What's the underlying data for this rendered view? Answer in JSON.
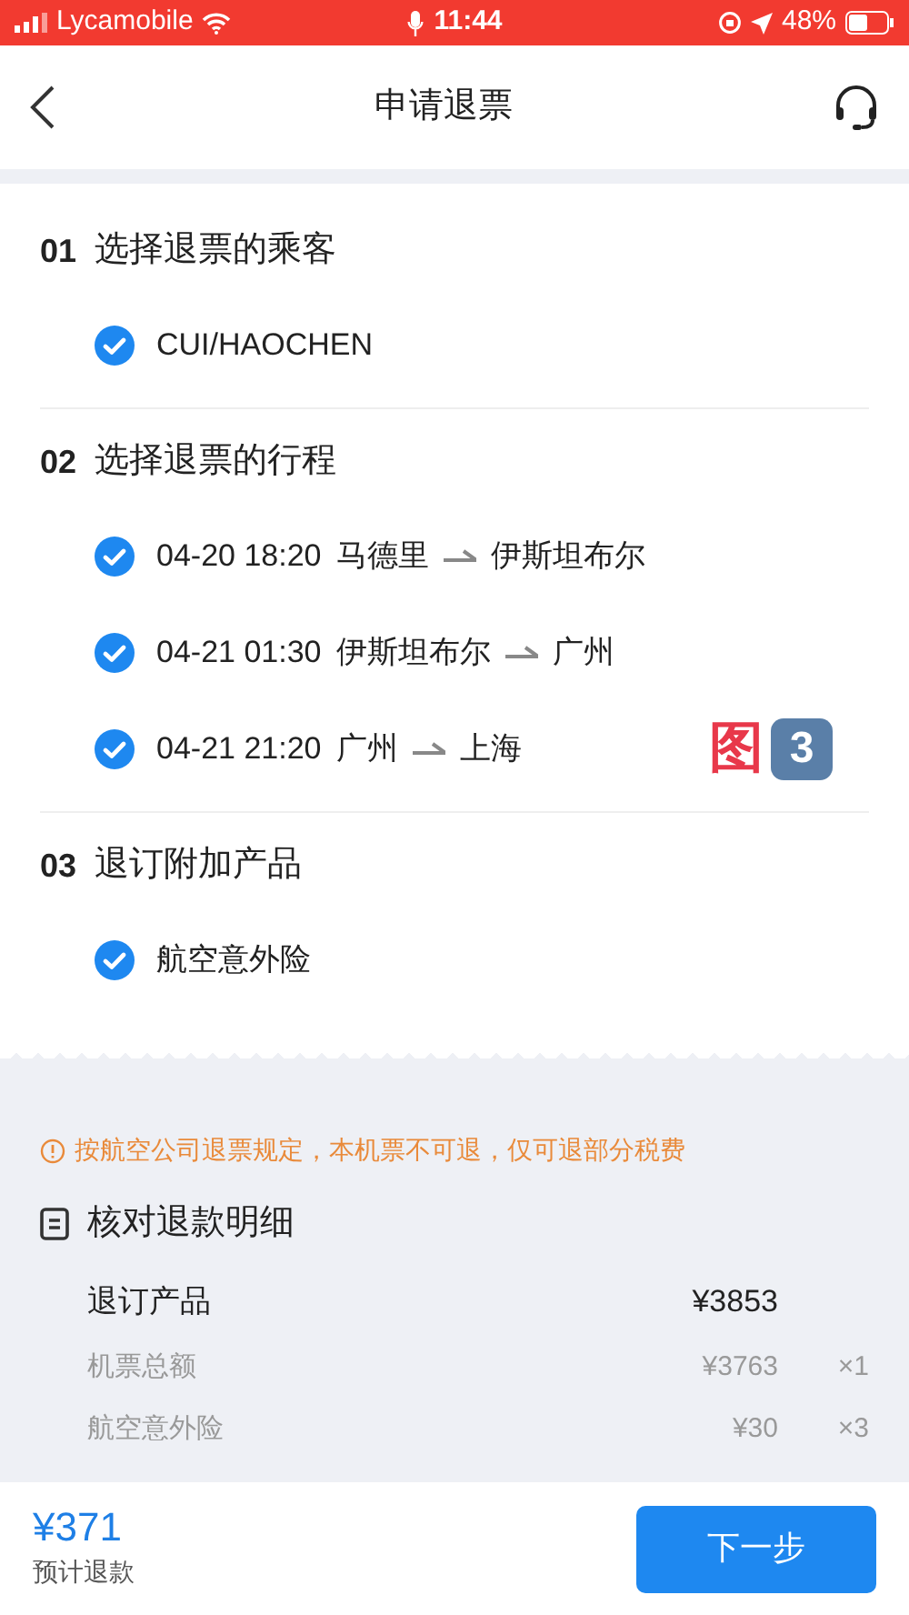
{
  "status_bar": {
    "carrier": "Lycamobile",
    "time": "11:44",
    "battery": "48%"
  },
  "header": {
    "title": "申请退票"
  },
  "sections": [
    {
      "number": "01",
      "title": "选择退票的乘客",
      "items": [
        {
          "kind": "text",
          "label": "CUI/HAOCHEN",
          "checked": true
        }
      ]
    },
    {
      "number": "02",
      "title": "选择退票的行程",
      "items": [
        {
          "kind": "leg",
          "datetime": "04-20 18:20",
          "from": "马德里",
          "to": "伊斯坦布尔",
          "checked": true
        },
        {
          "kind": "leg",
          "datetime": "04-21 01:30",
          "from": "伊斯坦布尔",
          "to": "广州",
          "checked": true
        },
        {
          "kind": "leg",
          "datetime": "04-21 21:20",
          "from": "广州",
          "to": "上海",
          "checked": true,
          "annotation": "图",
          "annotation_badge": "3"
        }
      ]
    },
    {
      "number": "03",
      "title": "退订附加产品",
      "items": [
        {
          "kind": "text",
          "label": "航空意外险",
          "checked": true
        }
      ]
    }
  ],
  "notice": "按航空公司退票规定，本机票不可退，仅可退部分税费",
  "refund": {
    "title": "核对退款明细",
    "rows": [
      {
        "kind": "main",
        "label": "退订产品",
        "amount": "¥3853"
      },
      {
        "kind": "sub",
        "label": "机票总额",
        "amount": "¥3763",
        "qty": "×1"
      },
      {
        "kind": "sub",
        "label": "航空意外险",
        "amount": "¥30",
        "qty": "×3"
      }
    ]
  },
  "footer": {
    "amount": "¥371",
    "amount_label": "预计退款",
    "button": "下一步"
  }
}
